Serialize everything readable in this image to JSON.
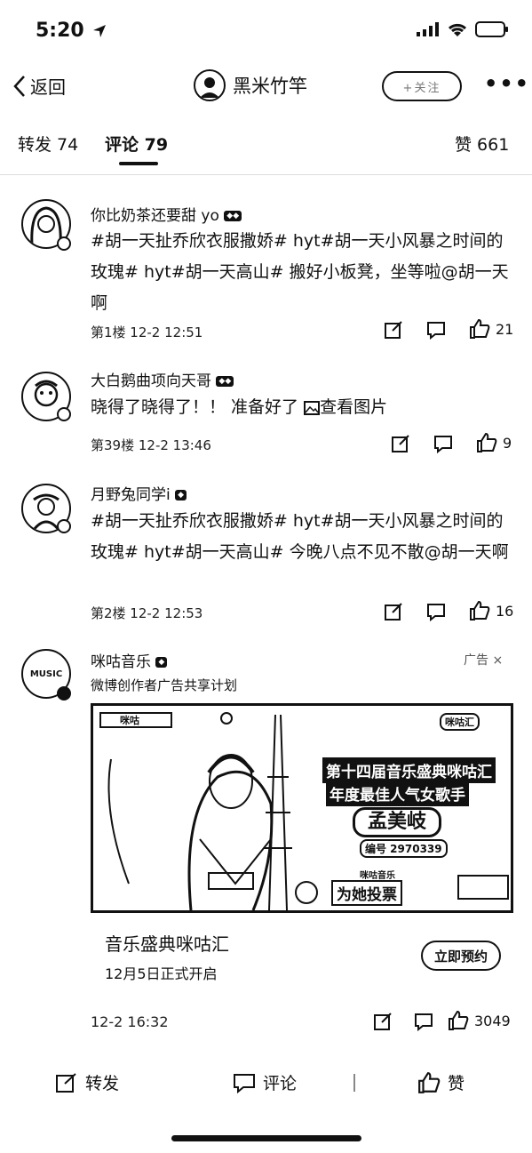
{
  "status_bar": {
    "time": "5:20"
  },
  "nav": {
    "back_label": "返回",
    "username": "黑米竹竿",
    "follow_label": "+关注",
    "more_label": "•••"
  },
  "tabs": {
    "repost": "转发 74",
    "comment": "评论 79",
    "like": "赞 661"
  },
  "comments": [
    {
      "username": "你比奶茶还要甜 yo",
      "text": "#胡一天扯乔欣衣服撒娇# hyt#胡一天小风暴之时间的玫瑰# hyt#胡一天高山# 搬好小板凳，坐等啦@胡一天啊",
      "floor_time": "第1楼 12-2 12:51",
      "likes": "21"
    },
    {
      "username": "大白鹅曲项向天哥",
      "text": "晓得了晓得了！！ 准备好了 ",
      "image_link": "查看图片",
      "floor_time": "第39楼 12-2 13:46",
      "likes": "9"
    },
    {
      "username": "月野兔同学i",
      "text": "#胡一天扯乔欣衣服撒娇# hyt#胡一天小风暴之时间的玫瑰# hyt#胡一天高山# 今晚八点不见不散@胡一天啊",
      "floor_time": "第2楼 12-2 12:53",
      "likes": "16"
    }
  ],
  "ad": {
    "account": "咪咕音乐",
    "ad_label": "广告",
    "subtitle": "微博创作者广告共享计划",
    "avatar_text": "MUSIC",
    "banner": {
      "logo_left": "咪咕",
      "logo_right": "咪咕汇",
      "headline1": "第十四届音乐盛典咪咕汇",
      "headline2": "年度最佳人气女歌手",
      "name": "孟美岐",
      "vote_code": "编号 2970339",
      "cta_small": "咪咕音乐",
      "cta_main": "为她投票"
    },
    "title": "音乐盛典咪咕汇",
    "desc": "12月5日正式开启",
    "cta": "立即预约",
    "time": "12-2 16:32",
    "likes": "3049"
  },
  "bottom_bar": {
    "repost": "转发",
    "comment": "评论",
    "like": "赞"
  }
}
